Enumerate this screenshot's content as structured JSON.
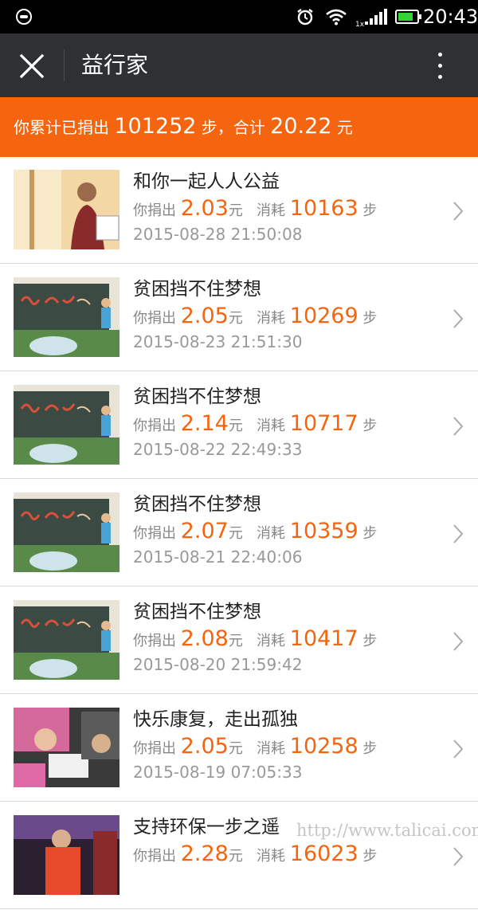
{
  "status_bar": {
    "time": "20:43",
    "signal_label": "1x",
    "battery_level": 0.8
  },
  "app_bar": {
    "title": "益行家"
  },
  "summary": {
    "prefix": "你累计已捐出",
    "steps": "101252",
    "steps_unit": "步，合计",
    "amount": "20.22",
    "amount_unit": "元"
  },
  "labels": {
    "donated": "你捐出",
    "yuan": "元",
    "consumed": "消耗",
    "steps": "步"
  },
  "items": [
    {
      "name": "和你一起人人公益",
      "amount": "2.03",
      "steps": "10163",
      "date": "2015-08-28 21:50:08",
      "thumb": "girl-with-book"
    },
    {
      "name": "贫困挡不住梦想",
      "amount": "2.05",
      "steps": "10269",
      "date": "2015-08-23 21:51:30",
      "thumb": "chalkboard"
    },
    {
      "name": "贫困挡不住梦想",
      "amount": "2.14",
      "steps": "10717",
      "date": "2015-08-22 22:49:33",
      "thumb": "chalkboard"
    },
    {
      "name": "贫困挡不住梦想",
      "amount": "2.07",
      "steps": "10359",
      "date": "2015-08-21 22:40:06",
      "thumb": "chalkboard"
    },
    {
      "name": "贫困挡不住梦想",
      "amount": "2.08",
      "steps": "10417",
      "date": "2015-08-20 21:59:42",
      "thumb": "chalkboard"
    },
    {
      "name": "快乐康复，走出孤独",
      "amount": "2.05",
      "steps": "10258",
      "date": "2015-08-19 07:05:33",
      "thumb": "children-drawing"
    },
    {
      "name": "支持环保一步之遥",
      "amount": "2.28",
      "steps": "16023",
      "date": "",
      "thumb": "worker"
    }
  ],
  "watermark": "http://www.talicai.com",
  "colors": {
    "accent": "#f5640f",
    "app_bar": "#2e3133",
    "status_bar": "#000000"
  }
}
